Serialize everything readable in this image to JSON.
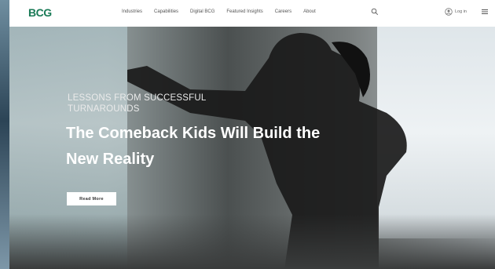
{
  "header": {
    "logo": "BCG",
    "nav": [
      "Industries",
      "Capabilities",
      "Digital BCG",
      "Featured Insights",
      "Careers",
      "About"
    ],
    "login_label": "Log in",
    "icons": [
      "search-icon",
      "user-icon",
      "menu-icon"
    ]
  },
  "hero": {
    "eyebrow": "Lessons From Successful Turnarounds",
    "headline": "The Comeback Kids Will Build the New Reality",
    "cta_label": "Read More"
  },
  "colors": {
    "brand": "#197a56",
    "cta_bg": "#ffffff",
    "headline": "#ffffff"
  }
}
